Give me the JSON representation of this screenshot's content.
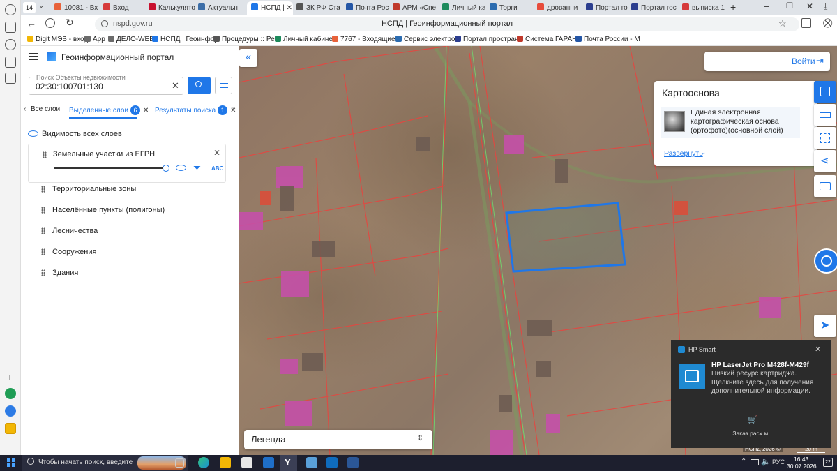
{
  "browser": {
    "tab_count": "14",
    "tabs": [
      {
        "label": "10081 - Вхо",
        "color": "#e8623a"
      },
      {
        "label": "Вход",
        "color": "#d63a3a"
      },
      {
        "label": "Калькулято",
        "color": "#c8102e"
      },
      {
        "label": "Актуальн",
        "color": "#3c6ea8"
      },
      {
        "label": "НСПД | ",
        "color": "#1f77e8"
      },
      {
        "label": "ЗК РФ Ста",
        "color": "#555555"
      },
      {
        "label": "Почта Рос",
        "color": "#2456a6"
      },
      {
        "label": "АРМ «Спе",
        "color": "#c0392b"
      },
      {
        "label": "Личный ка",
        "color": "#1d8a5c"
      },
      {
        "label": "Торги",
        "color": "#2b6cb0"
      },
      {
        "label": "дрованни",
        "color": "#e74c3c"
      },
      {
        "label": "Портал го",
        "color": "#2c3e8f"
      },
      {
        "label": "Портал гос",
        "color": "#2c3e8f"
      },
      {
        "label": "выписка 1",
        "color": "#d63a3a"
      }
    ],
    "url": "nspd.gov.ru",
    "page_title": "НСПД | Геоинформационный портал",
    "bookmarks": [
      {
        "label": "Digit МЭВ - вход",
        "color": "#f2b705"
      },
      {
        "label": "App",
        "color": "#6b6b6b"
      },
      {
        "label": "ДЕЛО-WEB",
        "color": "#6b6b6b"
      },
      {
        "label": "НСПД | Геоинфор",
        "color": "#1f77e8"
      },
      {
        "label": "Процедуры :: Реа",
        "color": "#555555"
      },
      {
        "label": "Личный кабинет",
        "color": "#1d8a5c"
      },
      {
        "label": "7767 - Входящие",
        "color": "#e8623a"
      },
      {
        "label": "Сервис электрон",
        "color": "#2b6cb0"
      },
      {
        "label": "Портал простран",
        "color": "#2c3e8f"
      },
      {
        "label": "Система ГАРАНТ",
        "color": "#c0392b"
      },
      {
        "label": "Почта России - М",
        "color": "#2456a6"
      }
    ]
  },
  "panel": {
    "header_title": "Геоинформационный портал",
    "search": {
      "placeholder": "Поиск Объекты недвижимости",
      "value": "02:30:100701:130"
    },
    "tabs": [
      {
        "label": "Все слои"
      },
      {
        "label": "Выделенные слои",
        "badge": "6"
      },
      {
        "label": "Результаты поиска",
        "badge": "1"
      }
    ],
    "visibility_label": "Видимость всех слоев",
    "active_layer": "Земельные участки из ЕГРН",
    "active_layer_opacity": 1.0,
    "layers": [
      "Территориальные зоны",
      "Населённые пункты (полигоны)",
      "Лесничества",
      "Сооружения",
      "Здания"
    ]
  },
  "map": {
    "login_label": "Войти",
    "basemap_card": {
      "title": "Картооснова",
      "layer_name": "Единая электронная картографическая основа (ортофото)(основной слой)",
      "expand_label": "Развернуть"
    },
    "legend_label": "Легенда",
    "footer_text": "НСПД 2026 ©",
    "scale_text": "20 m",
    "selection_color": "#1f77e8"
  },
  "toast": {
    "app": "HP Smart",
    "title": "HP LaserJet Pro M428f-M429f",
    "message": "Низкий ресурс картриджа. Щелкните здесь для получения дополнительной информации.",
    "action": "Заказ расх.м."
  },
  "taskbar": {
    "search_placeholder": "Чтобы начать поиск, введите",
    "language": "РУС",
    "time": "16:43",
    "date": "30.07.2026",
    "notification_count": "22"
  }
}
